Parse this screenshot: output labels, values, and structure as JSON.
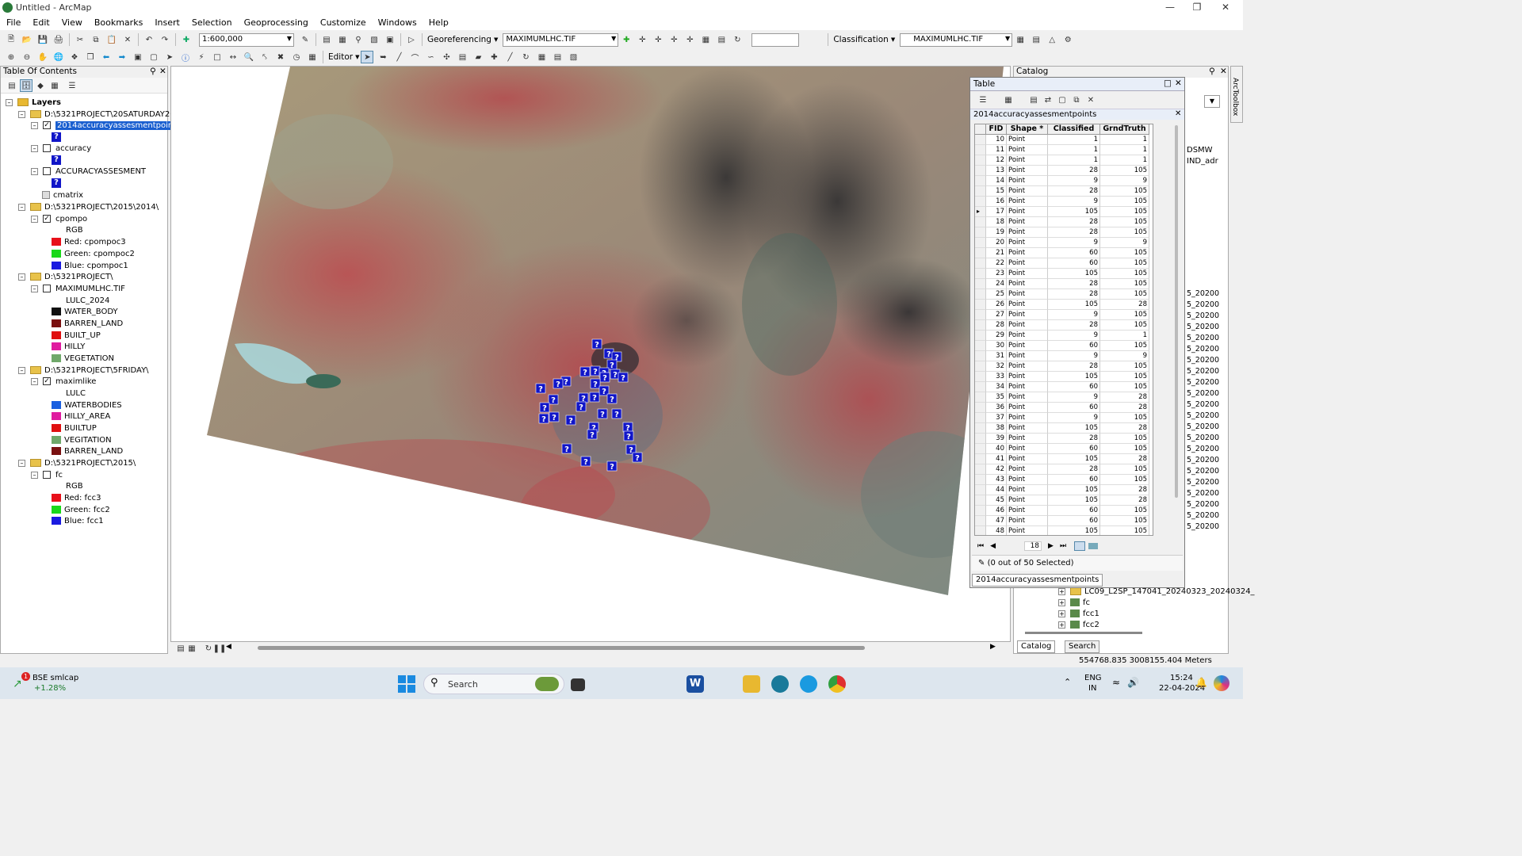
{
  "window": {
    "title": "Untitled - ArcMap"
  },
  "menu": [
    "File",
    "Edit",
    "View",
    "Bookmarks",
    "Insert",
    "Selection",
    "Geoprocessing",
    "Customize",
    "Windows",
    "Help"
  ],
  "toolbar": {
    "scale": "1:600,000",
    "georef_label": "Georeferencing",
    "georef_layer": "MAXIMUMLHC.TIF",
    "classification_label": "Classification",
    "classification_layer": "MAXIMUMLHC.TIF",
    "editor_label": "Editor"
  },
  "toc": {
    "title": "Table Of Contents",
    "layers_label": "Layers",
    "groups": [
      {
        "path": "D:\\5321PROJECT\\20SATURDAY20",
        "items": [
          {
            "name": "2014accuracyassesmentpoints",
            "checked": true,
            "selected": true
          },
          {
            "name": "accuracy",
            "checked": false
          },
          {
            "name": "ACCURACYASSESMENT",
            "checked": false
          },
          {
            "name": "cmatrix"
          }
        ]
      },
      {
        "path": "D:\\5321PROJECT\\2015\\2014\\",
        "layer": "cpompo",
        "sub": "RGB",
        "bands": [
          {
            "label": "Red:   cpompoc3",
            "color": "#e8101a"
          },
          {
            "label": "Green: cpompoc2",
            "color": "#1ad81a"
          },
          {
            "label": "Blue:  cpompoc1",
            "color": "#1a1ae0"
          }
        ]
      },
      {
        "path": "D:\\5321PROJECT\\",
        "layer": "MAXIMUMLHC.TIF",
        "sub": "LULC_2024",
        "classes": [
          {
            "label": "WATER_BODY",
            "color": "#111111"
          },
          {
            "label": "BARREN_LAND",
            "color": "#7a1010"
          },
          {
            "label": "BUILT_UP",
            "color": "#e01010"
          },
          {
            "label": "HILLY",
            "color": "#e01ca0"
          },
          {
            "label": "VEGETATION",
            "color": "#6fa86a"
          }
        ]
      },
      {
        "path": "D:\\5321PROJECT\\5FRIDAY\\",
        "layer": "maximlike",
        "sub": "LULC",
        "classes": [
          {
            "label": "WATERBODIES",
            "color": "#1a5fe0"
          },
          {
            "label": "HILLY_AREA",
            "color": "#e01ca0"
          },
          {
            "label": "BUILTUP",
            "color": "#e01010"
          },
          {
            "label": "VEGITATION",
            "color": "#6fa86a"
          },
          {
            "label": "BARREN_LAND",
            "color": "#7a1010"
          }
        ]
      },
      {
        "path": "D:\\5321PROJECT\\2015\\",
        "layer": "fc",
        "sub": "RGB",
        "bands": [
          {
            "label": "Red:   fcc3",
            "color": "#e8101a"
          },
          {
            "label": "Green: fcc2",
            "color": "#1ad81a"
          },
          {
            "label": "Blue:  fcc1",
            "color": "#1a1ae0"
          }
        ]
      }
    ]
  },
  "table": {
    "title": "Table",
    "layer_tab": "2014accuracyassesmentpoints",
    "columns": [
      "FID",
      "Shape *",
      "Classified",
      "GrndTruth"
    ],
    "rows": [
      [
        10,
        "Point",
        1,
        1
      ],
      [
        11,
        "Point",
        1,
        1
      ],
      [
        12,
        "Point",
        1,
        1
      ],
      [
        13,
        "Point",
        28,
        105
      ],
      [
        14,
        "Point",
        9,
        9
      ],
      [
        15,
        "Point",
        28,
        105
      ],
      [
        16,
        "Point",
        9,
        105
      ],
      [
        17,
        "Point",
        105,
        105
      ],
      [
        18,
        "Point",
        28,
        105
      ],
      [
        19,
        "Point",
        28,
        105
      ],
      [
        20,
        "Point",
        9,
        9
      ],
      [
        21,
        "Point",
        60,
        105
      ],
      [
        22,
        "Point",
        60,
        105
      ],
      [
        23,
        "Point",
        105,
        105
      ],
      [
        24,
        "Point",
        28,
        105
      ],
      [
        25,
        "Point",
        28,
        105
      ],
      [
        26,
        "Point",
        105,
        28
      ],
      [
        27,
        "Point",
        9,
        105
      ],
      [
        28,
        "Point",
        28,
        105
      ],
      [
        29,
        "Point",
        9,
        1
      ],
      [
        30,
        "Point",
        60,
        105
      ],
      [
        31,
        "Point",
        9,
        9
      ],
      [
        32,
        "Point",
        28,
        105
      ],
      [
        33,
        "Point",
        105,
        105
      ],
      [
        34,
        "Point",
        60,
        105
      ],
      [
        35,
        "Point",
        9,
        28
      ],
      [
        36,
        "Point",
        60,
        28
      ],
      [
        37,
        "Point",
        9,
        105
      ],
      [
        38,
        "Point",
        105,
        28
      ],
      [
        39,
        "Point",
        28,
        105
      ],
      [
        40,
        "Point",
        60,
        105
      ],
      [
        41,
        "Point",
        105,
        28
      ],
      [
        42,
        "Point",
        28,
        105
      ],
      [
        43,
        "Point",
        60,
        105
      ],
      [
        44,
        "Point",
        105,
        28
      ],
      [
        45,
        "Point",
        105,
        28
      ],
      [
        46,
        "Point",
        60,
        105
      ],
      [
        47,
        "Point",
        60,
        105
      ],
      [
        48,
        "Point",
        105,
        105
      ]
    ],
    "current_record": "18",
    "selection_status": "(0 out of 50 Selected)",
    "bottom_tab": "2014accuracyassesmentpoints"
  },
  "catalog": {
    "title": "Catalog",
    "partial_labels": [
      "DSMW",
      "IND_adr"
    ],
    "partial_dates": [
      "5_20200",
      "5_20200",
      "5_20200",
      "5_20200",
      "5_20200",
      "5_20200",
      "5_20200",
      "5_20200",
      "5_20200",
      "5_20200",
      "5_20200",
      "5_20200",
      "5_20200",
      "5_20200",
      "5_20200",
      "5_20200",
      "5_20200",
      "5_20200",
      "5_20200",
      "5_20200",
      "5_20200",
      "5_20200"
    ],
    "tree_items": [
      "LC09_L2SP_147041_20240323_20240324_",
      "fc",
      "fcc1",
      "fcc2"
    ],
    "tabs": [
      "Catalog",
      "Search"
    ],
    "toolbox_label": "ArcToolbox"
  },
  "status": {
    "coordinates": "554768.835  3008155.404 Meters"
  },
  "taskbar": {
    "widget_title": "BSE smlcap",
    "widget_value": "+1.28%",
    "search_placeholder": "Search",
    "lang": "ENG",
    "region": "IN",
    "time": "15:24",
    "date": "22-04-2024"
  }
}
